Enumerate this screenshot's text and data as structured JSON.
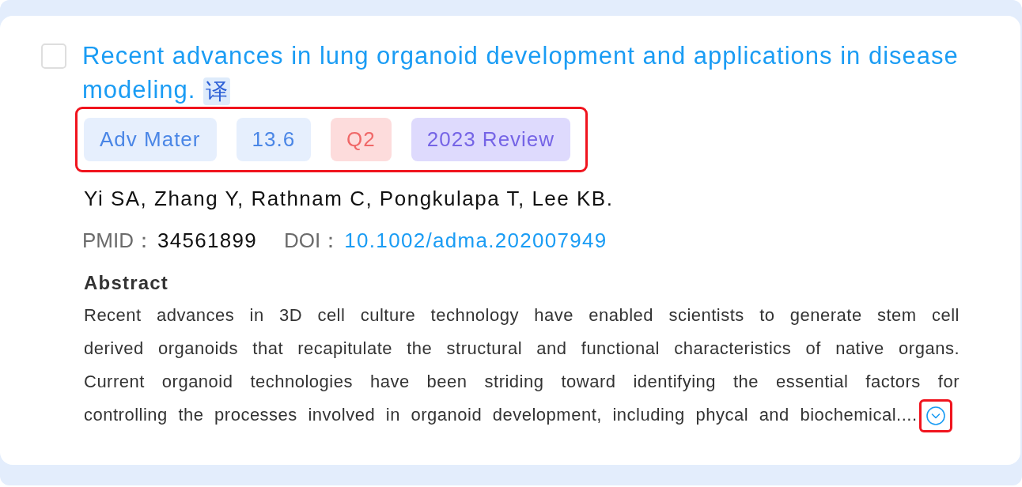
{
  "checkbox": {
    "checked": false
  },
  "title": {
    "text": "Recent advances in lung organoid development and applications in disease modeling.",
    "translate": "译"
  },
  "tags": {
    "highlighted": true,
    "items": [
      {
        "label": "Adv Mater",
        "kind": "journal"
      },
      {
        "label": "13.6",
        "kind": "impact_factor"
      },
      {
        "label": "Q2",
        "kind": "quartile"
      },
      {
        "label": "2023 Review",
        "kind": "category"
      }
    ]
  },
  "authors": "Yi SA, Zhang Y, Rathnam C, Pongkulapa T, Lee KB.",
  "identifiers": [
    {
      "label": "PMID：",
      "value": "34561899",
      "kind": "plain"
    },
    {
      "label": "DOI：",
      "value": "10.1002/adma.202007949",
      "kind": "link"
    }
  ],
  "abstract": {
    "heading": "Abstract",
    "text": "Recent advances in 3D cell culture technology have enabled scientists to generate stem cell derived organoids that recapitulate the structural and functional characteristics of native organs. Current organoid technologies have been striding toward identifying the essential factors for controlling the processes involved in organoid development, including phycal and biochemical....",
    "expand": {
      "highlighted": true
    }
  }
}
